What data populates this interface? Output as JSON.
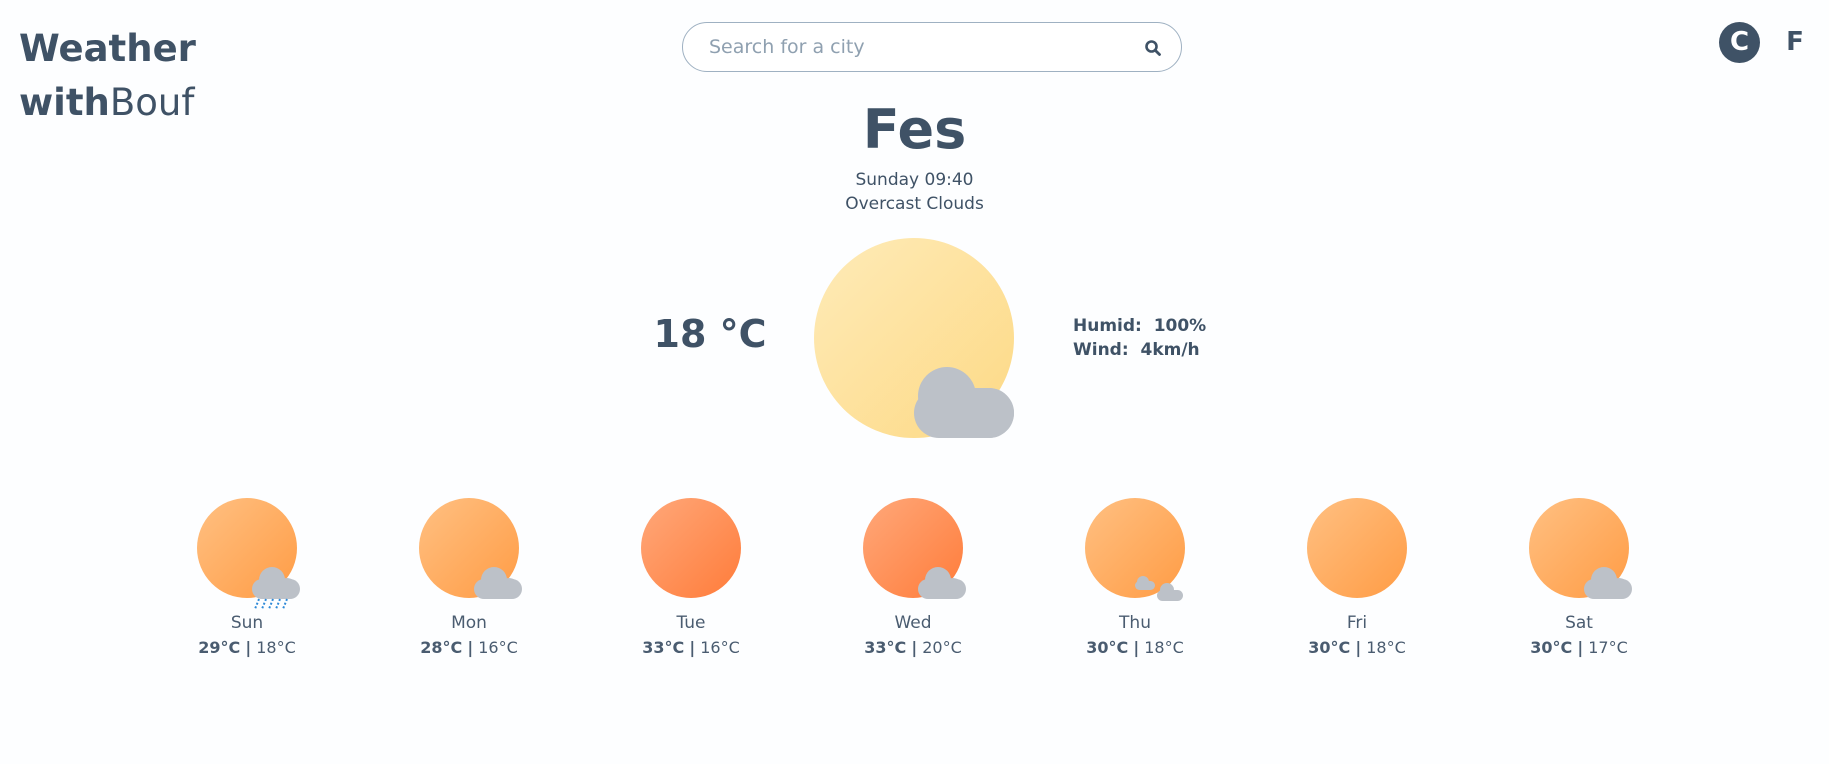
{
  "logo": {
    "bold": "with",
    "line1": "Weather",
    "light": "Bouf"
  },
  "search": {
    "placeholder": "Search for a city",
    "icon": "search-icon"
  },
  "units": {
    "celsius": "C",
    "fahrenheit": "F"
  },
  "current": {
    "city": "Fes",
    "datetime": "Sunday 09:40",
    "condition": "Overcast Clouds",
    "temperature": "18 °C",
    "humid_label": "Humid:",
    "humid_value": "100%",
    "wind_label": "Wind:",
    "wind_value": "4km/h",
    "icon": "sun-cloud-icon"
  },
  "colors": {
    "text": "#3f5266",
    "sun_pale": "#fde3a2",
    "sun_orange": "#ffb06a",
    "sun_hot": "#ff8a50",
    "cloud": "#bcc1c8",
    "rain": "#2f8ad8"
  },
  "forecast": [
    {
      "day": "Sun",
      "high": "29°C",
      "low": "18°C",
      "icon": "sun-rain-icon"
    },
    {
      "day": "Mon",
      "high": "28°C",
      "low": "16°C",
      "icon": "sun-cloud-icon"
    },
    {
      "day": "Tue",
      "high": "33°C",
      "low": "16°C",
      "icon": "hot-sun-icon"
    },
    {
      "day": "Wed",
      "high": "33°C",
      "low": "20°C",
      "icon": "hot-sun-cloud-icon"
    },
    {
      "day": "Thu",
      "high": "30°C",
      "low": "18°C",
      "icon": "sun-small-clouds-icon"
    },
    {
      "day": "Fri",
      "high": "30°C",
      "low": "18°C",
      "icon": "sun-icon"
    },
    {
      "day": "Sat",
      "high": "30°C",
      "low": "17°C",
      "icon": "sun-cloud-icon"
    }
  ],
  "separator": "|"
}
